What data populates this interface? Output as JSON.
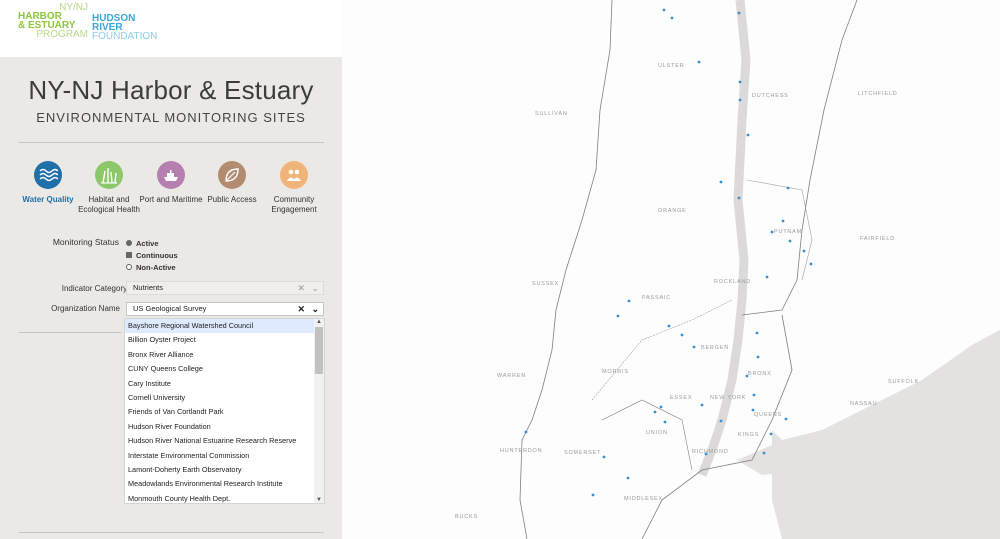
{
  "logos": {
    "nynj": [
      "NY/NJ",
      "HARBOR",
      "& ESTUARY",
      "PROGRAM"
    ],
    "hrf": [
      "HUDSON",
      "RIVER",
      "FOUNDATION"
    ]
  },
  "header": {
    "title": "NY-NJ Harbor & Estuary",
    "subtitle": "ENVIRONMENTAL MONITORING SITES"
  },
  "categories": [
    {
      "label": "Water Quality",
      "color": "#1f6fa8",
      "icon": "waves-icon",
      "active": true
    },
    {
      "label": "Habitat and Ecological Health",
      "color": "#8cc76a",
      "icon": "grass-icon",
      "active": false
    },
    {
      "label": "Port and Maritime",
      "color": "#b57fb0",
      "icon": "ship-icon",
      "active": false
    },
    {
      "label": "Public Access",
      "color": "#b28b70",
      "icon": "leaf-icon",
      "active": false
    },
    {
      "label": "Community Engagement",
      "color": "#f0b37a",
      "icon": "people-icon",
      "active": false
    }
  ],
  "monitoring": {
    "label": "Monitoring Status",
    "statuses": [
      {
        "label": "Active",
        "marker": "dot"
      },
      {
        "label": "Continuous",
        "marker": "square"
      },
      {
        "label": "Non-Active",
        "marker": "ring"
      }
    ]
  },
  "indicator": {
    "label": "Indicator Category",
    "help": "?",
    "value": "Nutrients"
  },
  "organization": {
    "label": "Organization Name",
    "value": "US Geological Survey",
    "options": [
      "Bayshore Regional Watershed Council",
      "Billion Oyster Project",
      "Bronx River Alliance",
      "CUNY Queens College",
      "Cary Institute",
      "Cornell University",
      "Friends of Van Cortlandt Park",
      "Hudson River Foundation",
      "Hudson River National Estuarine Research Reserve",
      "Interstate Environmental Commission",
      "Lamont-Doherty Earth Observatory",
      "Meadowlands Environmental Research Institute",
      "Monmouth County Health Dept."
    ]
  },
  "map": {
    "counties": [
      "ULSTER",
      "SULLIVAN",
      "DUTCHESS",
      "LITCHFIELD",
      "ORANGE",
      "PUTNAM",
      "FAIRFIELD",
      "SUSSEX",
      "PASSAIC",
      "ROCKLAND",
      "BERGEN",
      "WARREN",
      "MORRIS",
      "ESSEX",
      "BRONX",
      "NEW YORK",
      "NASSAU",
      "SUFFOLK",
      "QUEENS",
      "UNION",
      "KINGS",
      "HUNTERDON",
      "SOMERSET",
      "RICHMOND",
      "MIDDLESEX",
      "BUCKS"
    ],
    "site_color": "#3b8fd1"
  }
}
